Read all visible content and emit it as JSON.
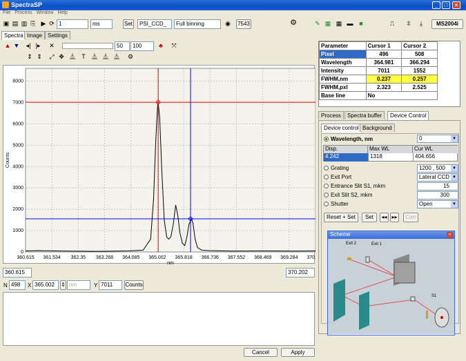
{
  "window": {
    "title": "SpectraSP"
  },
  "menu": [
    "File",
    "Process",
    "Window",
    "Help"
  ],
  "toolbar": {
    "count_value": "1",
    "unit": "ms",
    "set_label": "Set",
    "camera": "PSI_CCD_",
    "binning": "Full binning",
    "frame_value": "7543",
    "device": "MS2004i"
  },
  "tabs": [
    "Spectra",
    "Image",
    "Settings"
  ],
  "spectra_toolbar": {
    "from": "50",
    "to": "100"
  },
  "plot": {
    "xlabel": "nm",
    "ylabel": "Counts",
    "x_min_field": "360.615",
    "x_max_field": "370.202",
    "cursor_label_1": "365.002",
    "cursor_label_2": "365.818"
  },
  "chart_data": {
    "type": "line",
    "x_ticks": [
      "360.615",
      "361.534",
      "362.35",
      "363.268",
      "364.085",
      "365.002",
      "365.818",
      "366.736",
      "367.552",
      "368.469",
      "369.284",
      "370.202"
    ],
    "y_ticks": [
      0,
      1000,
      2000,
      3000,
      4000,
      5000,
      6000,
      7000,
      8000
    ],
    "xlim": [
      360.615,
      370.202
    ],
    "ylim": [
      0,
      8600
    ],
    "xlabel": "nm",
    "ylabel": "Counts",
    "series": [
      {
        "color": "#000000",
        "x": [
          360.615,
          361.0,
          362.0,
          363.0,
          364.0,
          364.5,
          364.75,
          364.85,
          364.92,
          364.98,
          365.0,
          365.05,
          365.12,
          365.2,
          365.28,
          365.35,
          365.42,
          365.5,
          365.58,
          365.65,
          365.72,
          365.8,
          365.88,
          365.95,
          366.02,
          366.1,
          366.15,
          366.22,
          366.3,
          366.45,
          366.7,
          367.5,
          368.5,
          369.5,
          370.202
        ],
        "y": [
          50,
          60,
          40,
          30,
          50,
          80,
          600,
          2500,
          5200,
          6800,
          7000,
          6300,
          3800,
          1500,
          700,
          600,
          700,
          1300,
          2200,
          1700,
          900,
          400,
          300,
          700,
          1300,
          1550,
          1350,
          600,
          200,
          80,
          60,
          40,
          50,
          40,
          50
        ]
      }
    ],
    "cursors": [
      {
        "name": "Cursor 1",
        "x": 365.002,
        "y": 7011,
        "color": "#ff0000"
      },
      {
        "name": "Cursor 2",
        "x": 366.07,
        "y": 1552,
        "color": "#0000ff"
      }
    ],
    "grid": true
  },
  "bottom": {
    "n_value": "498",
    "x_value": "365.002",
    "unit_placeholder": "nm",
    "y_value": "7011",
    "units_btn": "Counts",
    "cancel": "Cancel",
    "apply": "Apply"
  },
  "params": {
    "headers": [
      "Parameter",
      "Cursor 1",
      "Cursor 2"
    ],
    "rows": [
      [
        "Pixel",
        "496",
        "508"
      ],
      [
        "Wavelength",
        "364.981",
        "366.294"
      ],
      [
        "Intensity",
        "7011",
        "1552"
      ],
      [
        "FWHM,nm",
        "0.237",
        "0.257"
      ],
      [
        "FWHM,pxl",
        "2.323",
        "2.525"
      ],
      [
        "Base line",
        "No",
        ""
      ]
    ]
  },
  "right_tabs": [
    "Process",
    "Spectra buffer",
    "Device Control"
  ],
  "sub_tabs": [
    "Device control",
    "Background"
  ],
  "device": {
    "wavelength_label": "Wavelength, nm",
    "wavelength_select": "0",
    "table_headers": [
      "Disp.",
      "Max WL",
      "Cur WL"
    ],
    "table_values": [
      "4.242",
      "1318",
      "404.656"
    ],
    "grating_label": "Grating",
    "grating_value": "1200 , 500",
    "exit_port_label": "Exit Port",
    "exit_port_value": "Lateral CCD",
    "entrance_label": "Entrance Slit S1, mkm",
    "entrance_value": "15",
    "exit_slit_label": "Exit Slit S2, mkm",
    "exit_slit_value": "300",
    "shutter_label": "Shutter",
    "shutter_value": "Open",
    "reset_set": "Reset + Set",
    "set": "Set",
    "prev": "◂◂",
    "next": "▸▸",
    "corr": "Corr"
  },
  "scheme": {
    "title": "Scheme",
    "exit2": "Exit 2",
    "exit1": "Exit 1",
    "s1": "S1"
  }
}
